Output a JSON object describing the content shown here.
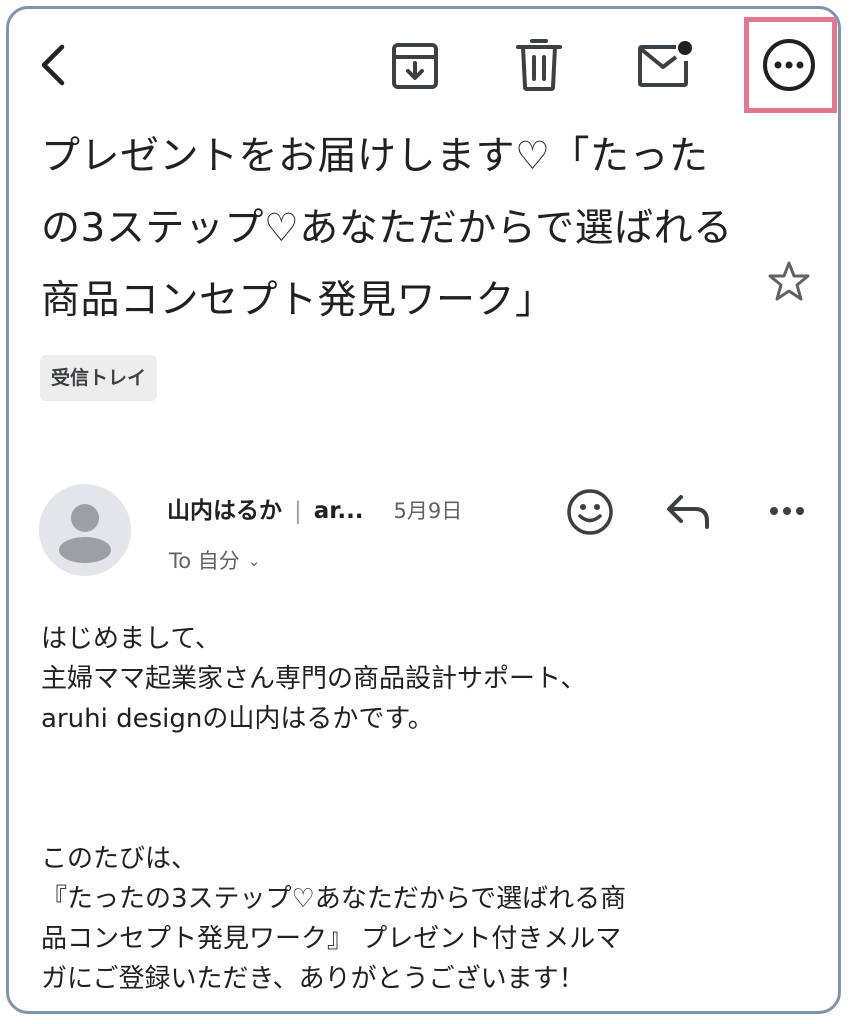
{
  "toolbar": {
    "back": "back-arrow-icon",
    "archive": "archive-icon",
    "delete": "trash-icon",
    "mark_unread": "mail-unread-icon",
    "more": "more-horizontal-circle-icon"
  },
  "colors": {
    "frame_border": "#7f95ad",
    "highlight_border": "#e07a8e",
    "label_chip_bg": "#ededed",
    "icon_color": "#3c4043"
  },
  "email": {
    "subject": "プレゼントをお届けします♡「たったの3ステップ♡あなただからで選ばれる商品コンセプト発見ワーク」",
    "label": "受信トレイ",
    "sender": {
      "name": "山内はるか",
      "short_address": "ar...",
      "date": "5月9日",
      "to": "To 自分"
    },
    "body_paragraph1": [
      "はじめまして、",
      "主婦ママ起業家さん専門の商品設計サポート、",
      "aruhi designの山内はるかです。"
    ],
    "body_paragraph2": [
      "このたびは、",
      "『たったの3ステップ♡あなただからで選ばれる商",
      "品コンセプト発見ワーク』 プレゼント付きメルマ",
      "ガにご登録いただき、ありがとうございます！"
    ]
  }
}
